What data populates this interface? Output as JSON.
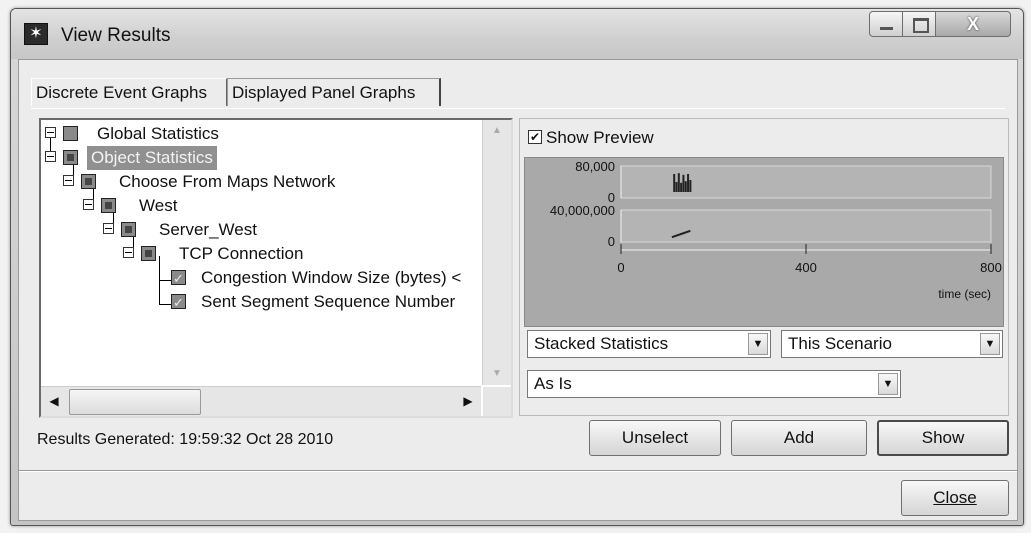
{
  "window": {
    "title": "View Results",
    "close_glyph": "X"
  },
  "tabs": [
    {
      "label": "Discrete Event Graphs",
      "active": true
    },
    {
      "label": "Displayed Panel Graphs",
      "active": false
    }
  ],
  "tree": {
    "items": [
      {
        "label": "Global Statistics",
        "level": 0,
        "selected": false
      },
      {
        "label": "Object Statistics",
        "level": 0,
        "selected": true
      },
      {
        "label": "Choose From Maps Network",
        "level": 1,
        "selected": false
      },
      {
        "label": "West",
        "level": 2,
        "selected": false
      },
      {
        "label": "Server_West",
        "level": 3,
        "selected": false
      },
      {
        "label": "TCP Connection",
        "level": 4,
        "selected": false
      },
      {
        "label": "Congestion Window Size (bytes) <",
        "level": 5,
        "selected": false
      },
      {
        "label": "Sent Segment Sequence Number",
        "level": 5,
        "selected": false
      }
    ]
  },
  "preview": {
    "show_preview_label": "Show Preview",
    "show_preview_checked": true,
    "chart_data": {
      "type": "line",
      "panels": [
        {
          "y_ticks": [
            "80,000",
            "0"
          ],
          "ylim": [
            0,
            80000
          ],
          "description": "Congestion Window Size (bytes)"
        },
        {
          "y_ticks": [
            "40,000,000",
            "0"
          ],
          "ylim": [
            0,
            40000000
          ],
          "description": "Sent Segment Sequence Number"
        }
      ],
      "x_ticks": [
        "0",
        "400",
        "800"
      ],
      "xlim": [
        0,
        800
      ],
      "xlabel": "time (sec)",
      "series": [
        {
          "values_x": [
            115,
            120,
            125,
            130,
            135,
            140,
            145,
            150
          ],
          "values_y": [
            60000,
            40000,
            62000,
            38000,
            58000,
            42000,
            60000,
            45000
          ]
        },
        {
          "values_x": [
            110,
            130,
            150
          ],
          "values_y": [
            6000000,
            10000000,
            14000000
          ]
        }
      ]
    }
  },
  "dropdowns": {
    "stack_mode": "Stacked Statistics",
    "scenario": "This Scenario",
    "filter": "As Is"
  },
  "status": {
    "results_generated": "Results Generated: 19:59:32 Oct 28 2010"
  },
  "buttons": {
    "unselect": "Unselect",
    "add": "Add",
    "show": "Show",
    "close": "Close"
  }
}
